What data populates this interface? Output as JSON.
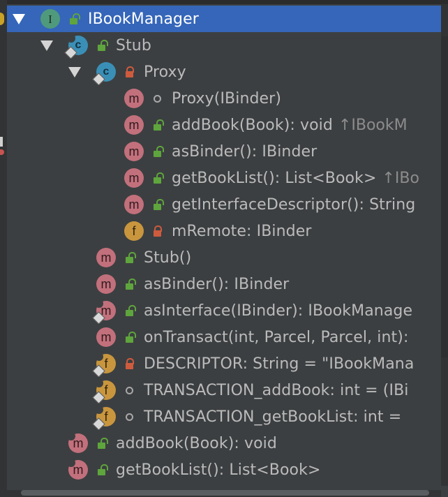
{
  "tree": {
    "root": {
      "label": "IBookManager",
      "badge": "I",
      "expanded": true,
      "visibility": "public"
    },
    "stub": {
      "label": "Stub",
      "badge": "c",
      "expanded": true,
      "visibility": "public"
    },
    "proxy": {
      "label": "Proxy",
      "badge": "c",
      "expanded": true,
      "visibility": "private"
    },
    "proxy_members": [
      {
        "label": "Proxy(IBinder)",
        "badge": "m",
        "visibility": "package",
        "suffix": ""
      },
      {
        "label": "addBook(Book): void",
        "badge": "m",
        "visibility": "public",
        "suffix": "↑IBookM"
      },
      {
        "label": "asBinder(): IBinder",
        "badge": "m",
        "visibility": "public",
        "suffix": ""
      },
      {
        "label": "getBookList(): List<Book>",
        "badge": "m",
        "visibility": "public",
        "suffix": "↑IBo"
      },
      {
        "label": "getInterfaceDescriptor(): String",
        "badge": "m",
        "visibility": "public",
        "suffix": ""
      },
      {
        "label": "mRemote: IBinder",
        "badge": "f",
        "visibility": "private",
        "suffix": ""
      }
    ],
    "stub_members": [
      {
        "label": "Stub()",
        "badge": "m",
        "visibility": "public"
      },
      {
        "label": "asBinder(): IBinder",
        "badge": "m",
        "visibility": "public"
      },
      {
        "label": "asInterface(IBinder): IBookManage",
        "badge": "m",
        "visibility": "public"
      },
      {
        "label": "onTransact(int, Parcel, Parcel, int):",
        "badge": "m",
        "visibility": "public"
      },
      {
        "label": "DESCRIPTOR: String = \"IBookMana",
        "badge": "f",
        "visibility": "private"
      },
      {
        "label": "TRANSACTION_addBook: int = (IBi",
        "badge": "f",
        "visibility": "package"
      },
      {
        "label": "TRANSACTION_getBookList: int =",
        "badge": "f",
        "visibility": "package"
      }
    ],
    "root_members": [
      {
        "label": "addBook(Book): void",
        "badge": "m",
        "visibility": "public"
      },
      {
        "label": "getBookList(): List<Book>",
        "badge": "m",
        "visibility": "public"
      }
    ]
  },
  "colors": {
    "background": "#3c3f41",
    "selection": "#3566b9",
    "interface_badge": "#4f9a7c",
    "class_badge": "#3a8fb7",
    "method_badge": "#c2707c",
    "field_badge": "#c9963e",
    "public_lock": "#5fa53d",
    "private_lock": "#cf5b3e"
  }
}
